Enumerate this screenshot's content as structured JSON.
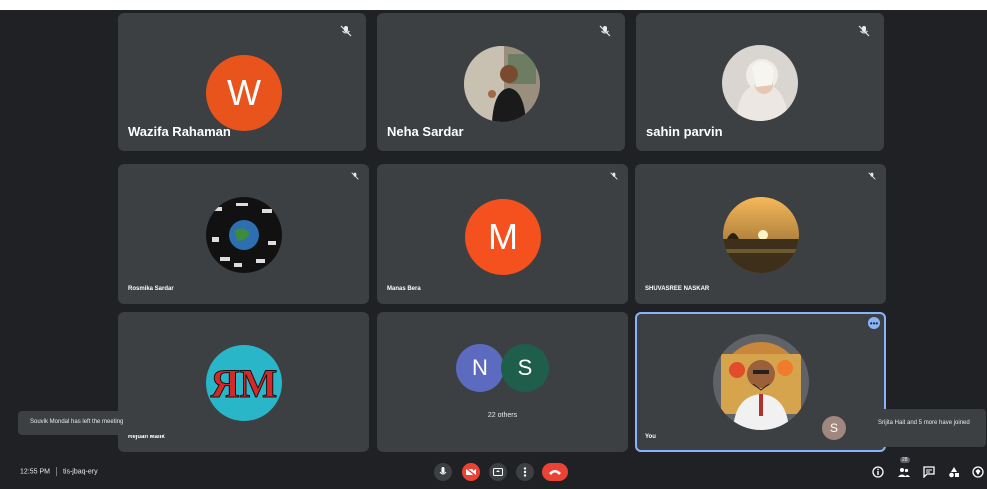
{
  "participants": [
    {
      "name": "Wazifa Rahaman",
      "letter": "W",
      "color": "#e8541c"
    },
    {
      "name": "Neha Sardar"
    },
    {
      "name": "sahin parvin"
    },
    {
      "name": "Rosmika Sardar"
    },
    {
      "name": "Manas Bera",
      "letter": "M",
      "color": "#f4511e"
    },
    {
      "name": "SHUVASREE NASKAR"
    },
    {
      "name": "Rejuan Malik"
    },
    {
      "name": "22 others",
      "letters": [
        "N",
        "S"
      ],
      "colors": [
        "#5c6bc0",
        "#1e5e4a"
      ]
    },
    {
      "name": "You"
    }
  ],
  "toasts": {
    "left": "Souvik Mondal has left the meeting",
    "right_letter": "S",
    "right": "Srijita Hait and 5 more have joined"
  },
  "meeting": {
    "time": "12:55 PM",
    "code": "tis-jbaq-ery",
    "people_count": "28"
  },
  "icons": [
    "mic-off-icon",
    "mic-icon",
    "camera-off-icon",
    "present-icon",
    "more-icon",
    "end-call-icon",
    "info-icon",
    "people-icon",
    "chat-icon",
    "activities-icon",
    "host-controls-icon"
  ]
}
